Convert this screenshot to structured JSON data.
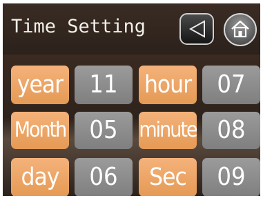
{
  "header": {
    "title": "Time Setting",
    "back_icon": "back-triangle-icon",
    "home_icon": "home-icon"
  },
  "rows": [
    {
      "left_label": "year",
      "left_value": "11",
      "right_label": "hour",
      "right_value": "07"
    },
    {
      "left_label": "Month",
      "left_value": "05",
      "right_label": "minute",
      "right_value": "08"
    },
    {
      "left_label": "day",
      "left_value": "06",
      "right_label": "Sec",
      "right_value": "09"
    }
  ],
  "colors": {
    "background": "#33261f",
    "label_orange": "#ec a462",
    "value_gray": "#8c8c8c",
    "text": "#ffffff"
  }
}
